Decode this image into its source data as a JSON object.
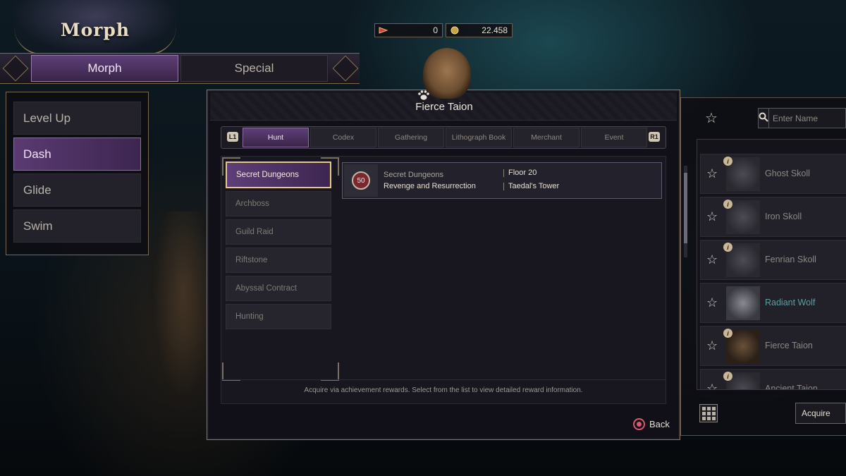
{
  "header": {
    "title": "Morph",
    "currencies": [
      {
        "icon": "ticket-icon",
        "value": "0"
      },
      {
        "icon": "gold-coin-icon",
        "value": "22.458"
      }
    ]
  },
  "mode_tabs": [
    {
      "label": "Morph",
      "active": true
    },
    {
      "label": "Special",
      "active": false
    }
  ],
  "side_menu": [
    {
      "label": "Level Up",
      "active": false
    },
    {
      "label": "Dash",
      "active": true
    },
    {
      "label": "Glide",
      "active": false
    },
    {
      "label": "Swim",
      "active": false
    }
  ],
  "dialog": {
    "title": "Fierce Taion",
    "left_hint": "L1",
    "right_hint": "R1",
    "categories": [
      {
        "label": "Hunt",
        "active": true
      },
      {
        "label": "Codex",
        "active": false
      },
      {
        "label": "Gathering",
        "active": false
      },
      {
        "label": "Lithograph Book",
        "active": false
      },
      {
        "label": "Merchant",
        "active": false
      },
      {
        "label": "Event",
        "active": false
      }
    ],
    "sub_items": [
      {
        "label": "Secret Dungeons",
        "active": true
      },
      {
        "label": "Archboss",
        "active": false
      },
      {
        "label": "Guild Raid",
        "active": false
      },
      {
        "label": "Riftstone",
        "active": false
      },
      {
        "label": "Abyssal Contract",
        "active": false
      },
      {
        "label": "Hunting",
        "active": false
      }
    ],
    "entry": {
      "level": "50",
      "category": "Secret Dungeons",
      "name": "Revenge and Resurrection",
      "floor": "Floor 20",
      "location": "Taedal's Tower"
    },
    "hint": "Acquire via achievement rewards. Select from the list to view detailed reward information.",
    "back_label": "Back"
  },
  "right_panel": {
    "search_placeholder": "Enter Name",
    "morphs": [
      {
        "name": "Ghost Skoll",
        "teal": false
      },
      {
        "name": "Iron Skoll",
        "teal": false
      },
      {
        "name": "Fenrian Skoll",
        "teal": false
      },
      {
        "name": "Radiant Wolf",
        "teal": true
      },
      {
        "name": "Fierce Taion",
        "teal": false
      },
      {
        "name": "Ancient Taion",
        "teal": false
      }
    ],
    "acquire_label": "Acquire"
  },
  "colors": {
    "accent_purple": "#5e3e78",
    "gold_border": "#e3c98a",
    "teal_text": "#5f9ea0",
    "back_button": "#d85a6a"
  }
}
